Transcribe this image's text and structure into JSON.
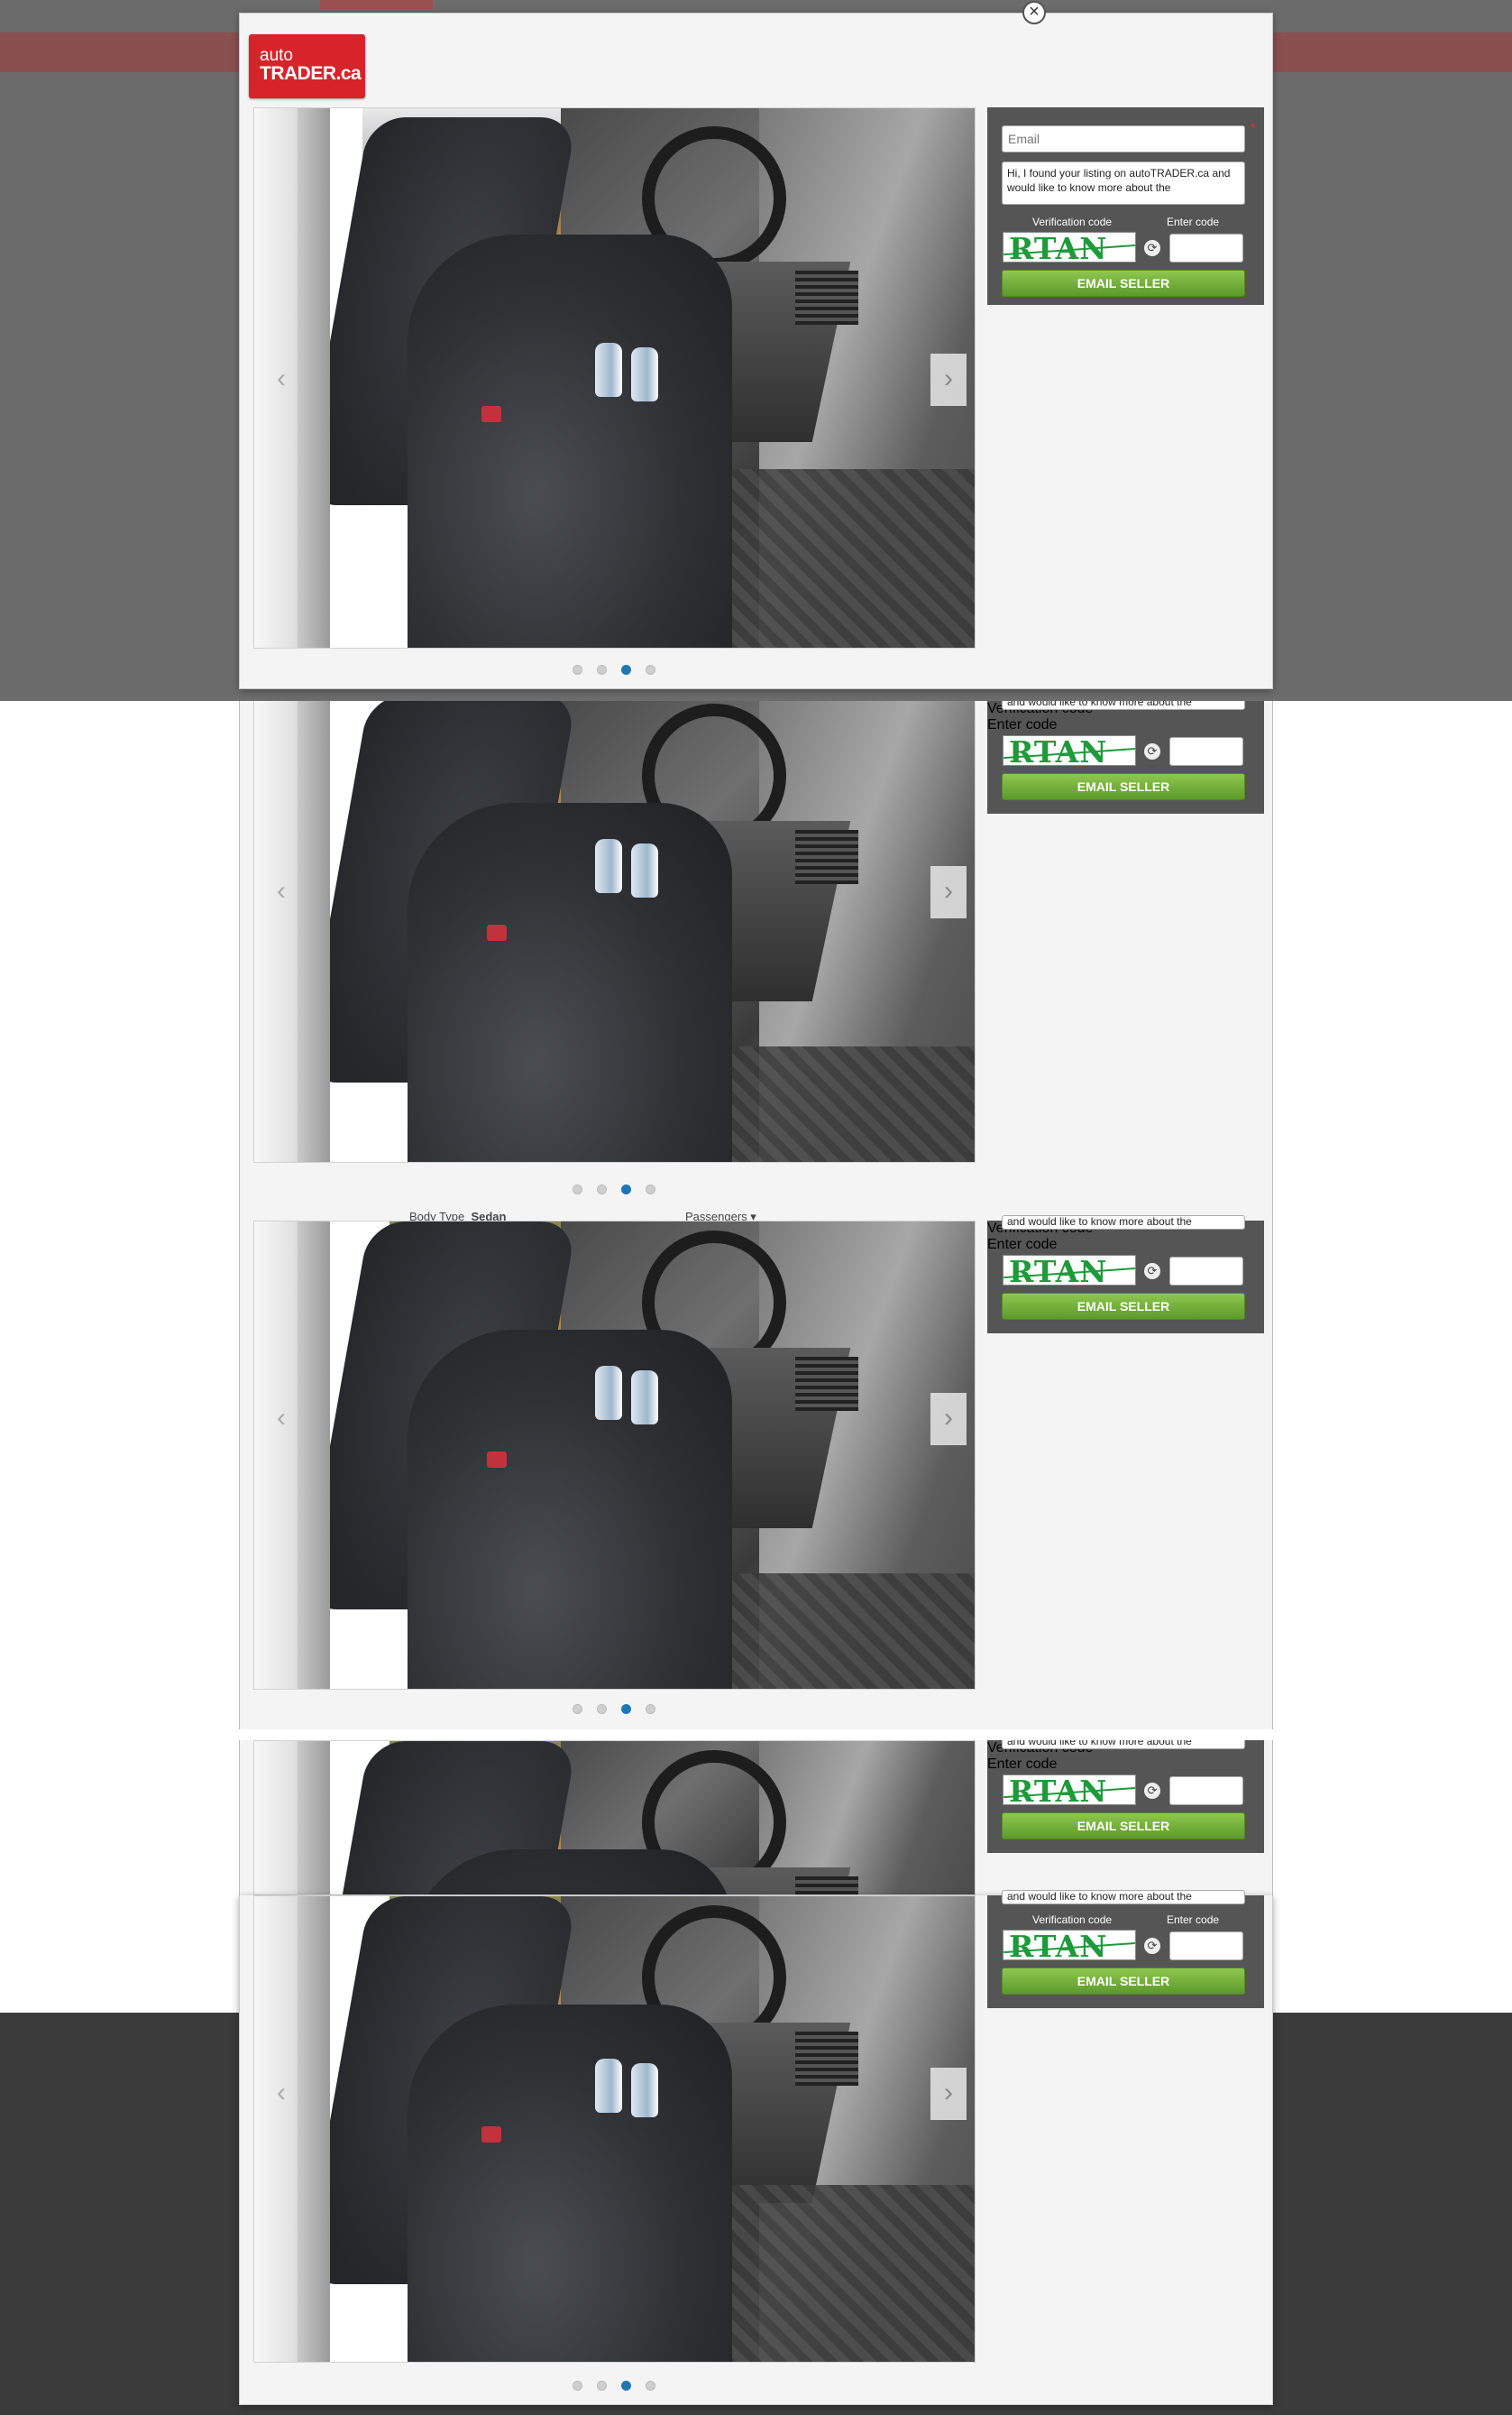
{
  "site": {
    "logo_line1": "auto",
    "logo_line2": "TRADER.ca"
  },
  "modal": {
    "close_glyph": "×",
    "prev_glyph": "‹",
    "next_glyph": "›"
  },
  "contact": {
    "email_placeholder": "Email",
    "required_mark": "*",
    "message": "Hi, I found your listing on autoTRADER.ca and would like to know more about the",
    "message_partial": "and would like to know more about the",
    "verification_label": "Verification code",
    "enter_code_label": "Enter code",
    "captcha_text": "RTAN",
    "refresh_glyph": "⟳",
    "email_button": "EMAIL SELLER"
  },
  "behind": {
    "body_type_label": "Body Type",
    "body_type_value": "Sedan",
    "passengers_label": "Passengers"
  },
  "gallery": {
    "slides": 4,
    "active_slide": 3
  },
  "colors": {
    "brand_red": "#d8232a",
    "button_green": "#6aab35",
    "active_dot": "#1d77b5",
    "sidebar_bg": "#555555"
  }
}
